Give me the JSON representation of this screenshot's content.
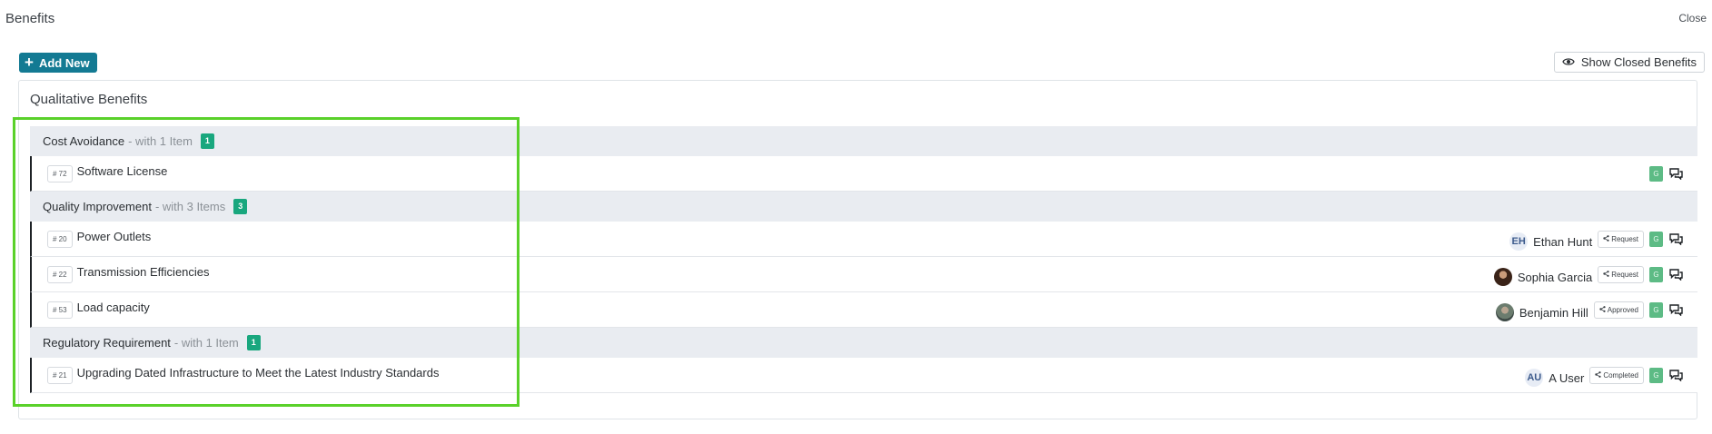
{
  "header": {
    "title": "Benefits",
    "close_label": "Close"
  },
  "toolbar": {
    "add_label": "Add New",
    "show_closed_label": "Show Closed Benefits"
  },
  "panel": {
    "title": "Qualitative Benefits"
  },
  "groups": [
    {
      "name": "Cost Avoidance",
      "subtitle": "- with 1 Item",
      "count": "1",
      "items": [
        {
          "id": "# 72",
          "title": "Software License",
          "g": "G"
        }
      ]
    },
    {
      "name": "Quality Improvement",
      "subtitle": "- with 3 Items",
      "count": "3",
      "items": [
        {
          "id": "# 20",
          "title": "Power Outlets",
          "initials": "EH",
          "person": "Ethan Hunt",
          "status": "Request",
          "g": "G"
        },
        {
          "id": "# 22",
          "title": "Transmission Efficiencies",
          "person": "Sophia Garcia",
          "status": "Request",
          "g": "G"
        },
        {
          "id": "# 53",
          "title": "Load capacity",
          "person": "Benjamin Hill",
          "status": "Approved",
          "g": "G"
        }
      ]
    },
    {
      "name": "Regulatory Requirement",
      "subtitle": "- with 1 Item",
      "count": "1",
      "items": [
        {
          "id": "# 21",
          "title": "Upgrading Dated Infrastructure to Meet the Latest Industry Standards",
          "initials": "AU",
          "person": "A User",
          "status": "Completed",
          "g": "G"
        }
      ]
    }
  ],
  "colors": {
    "accent": "#137a93",
    "count_badge": "#19a77e",
    "highlight": "#5ad12a"
  },
  "icons": {
    "add": "plus-icon",
    "show_closed": "eye-icon",
    "status": "share-icon",
    "comments": "chat-icon"
  }
}
